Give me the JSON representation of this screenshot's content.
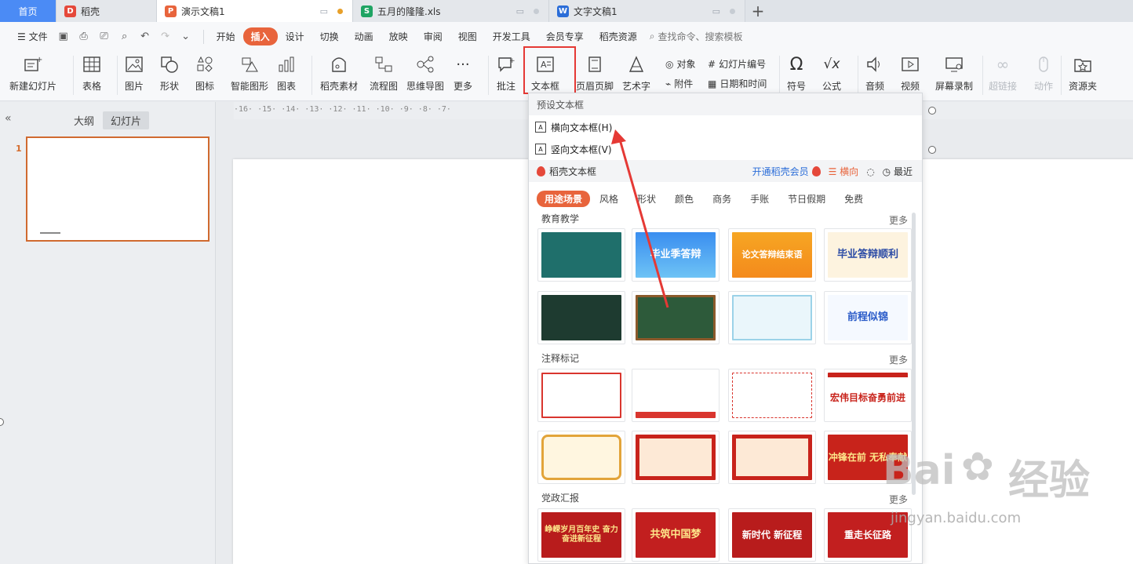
{
  "tabs": [
    {
      "label": "首页"
    },
    {
      "label": "稻壳"
    },
    {
      "label": "演示文稿1"
    },
    {
      "label": "五月的隆隆.xls"
    },
    {
      "label": "文字文稿1"
    }
  ],
  "tab_add": "+",
  "menu": {
    "file": "文件",
    "items": [
      "开始",
      "插入",
      "设计",
      "切换",
      "动画",
      "放映",
      "审阅",
      "视图",
      "开发工具",
      "会员专享",
      "稻壳资源"
    ],
    "search_placeholder": "查找命令、搜索模板"
  },
  "ribbon": {
    "new_slide": "新建幻灯片",
    "table": "表格",
    "picture": "图片",
    "shape": "形状",
    "icon": "图标",
    "smartart": "智能图形",
    "chart": "图表",
    "material": "稻壳素材",
    "flowchart": "流程图",
    "mindmap": "思维导图",
    "more": "更多",
    "comment": "批注",
    "textbox": "文本框",
    "header_footer": "页眉页脚",
    "wordart": "艺术字",
    "object": "对象",
    "attachment": "附件",
    "slide_number": "幻灯片编号",
    "datetime": "日期和时间",
    "symbol": "符号",
    "formula": "公式",
    "audio": "音频",
    "video": "视频",
    "screen_record": "屏幕录制",
    "hyperlink": "超链接",
    "action": "动作",
    "resource": "资源夹"
  },
  "left_panel": {
    "tab_outline": "大纲",
    "tab_slides": "幻灯片",
    "slide_number": "1"
  },
  "ruler_text": "·16·  ·15·  ·14·  ·13·  ·12·  ·11·  ·10·  ·9·  ·8·  ·7·",
  "dropdown": {
    "header": "预设文本框",
    "horizontal": "横向文本框(H)",
    "vertical": "竖向文本框(V)",
    "daoke_label": "稻壳文本框",
    "vip_label": "开通稻壳会员",
    "horizontal_toggle": "横向",
    "recent": "最近",
    "categories": [
      "用途场景",
      "风格",
      "形状",
      "颜色",
      "商务",
      "手账",
      "节日假期",
      "免费"
    ],
    "sections": [
      {
        "title": "教育教学",
        "more": "更多"
      },
      {
        "title": "注释标记",
        "more": "更多"
      },
      {
        "title": "党政汇报",
        "more": "更多"
      }
    ],
    "thumbs": {
      "edu": [
        "",
        "毕业季答辩",
        "论文答辩结束语",
        "毕业答辩顺利",
        "",
        "",
        "",
        "前程似锦"
      ],
      "note": [
        "",
        "",
        "",
        "宏伟目标奋勇前进",
        "",
        "",
        "",
        "冲锋在前 无私奉献"
      ],
      "party": [
        "峥嵘岁月百年史 奋力奋进新征程",
        "共筑中国梦",
        "新时代 新征程",
        "重走长征路"
      ]
    }
  },
  "watermark": {
    "brand": "Bai",
    "brand2": "经验",
    "url": "jingyan.baidu.com"
  },
  "colors": {
    "accent": "#e8643c",
    "home_tab": "#4b8bf5",
    "highlight": "#e53935"
  }
}
